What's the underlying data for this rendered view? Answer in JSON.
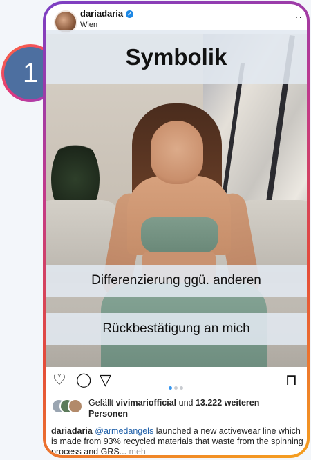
{
  "post": {
    "username": "dariadaria",
    "verified_mark": "✓",
    "location": "Wien",
    "more_label": "··"
  },
  "overlay": {
    "badge_number": "1",
    "title": "Symbolik",
    "subtitle_1": "Differenzierung ggü. anderen",
    "subtitle_2": "Rückbestätigung an mich"
  },
  "actions": {
    "like_icon": "♡",
    "comment_icon": "◯",
    "share_icon": "▽",
    "save_icon": "⊓",
    "carousel_pages": 3,
    "carousel_active": 1
  },
  "likes": {
    "prefix": "Gefällt ",
    "user": "vivimariofficial",
    "middle": " und ",
    "count": "13.222 weiteren",
    "suffix": "Personen"
  },
  "caption": {
    "user": "dariadaria",
    "mention": "@armedangels",
    "text": " launched a new activewear line which is made from 93% recycled materials that waste from the spinning process and GRS...",
    "more": " meh"
  },
  "colors": {
    "border_gradient": [
      "#7b3fc4",
      "#c2398a",
      "#e44b3a",
      "#f5a020"
    ],
    "badge_fill": "#4d6fa0",
    "banner_bg": "#e1e8f0",
    "mention": "#1f5fa8"
  }
}
